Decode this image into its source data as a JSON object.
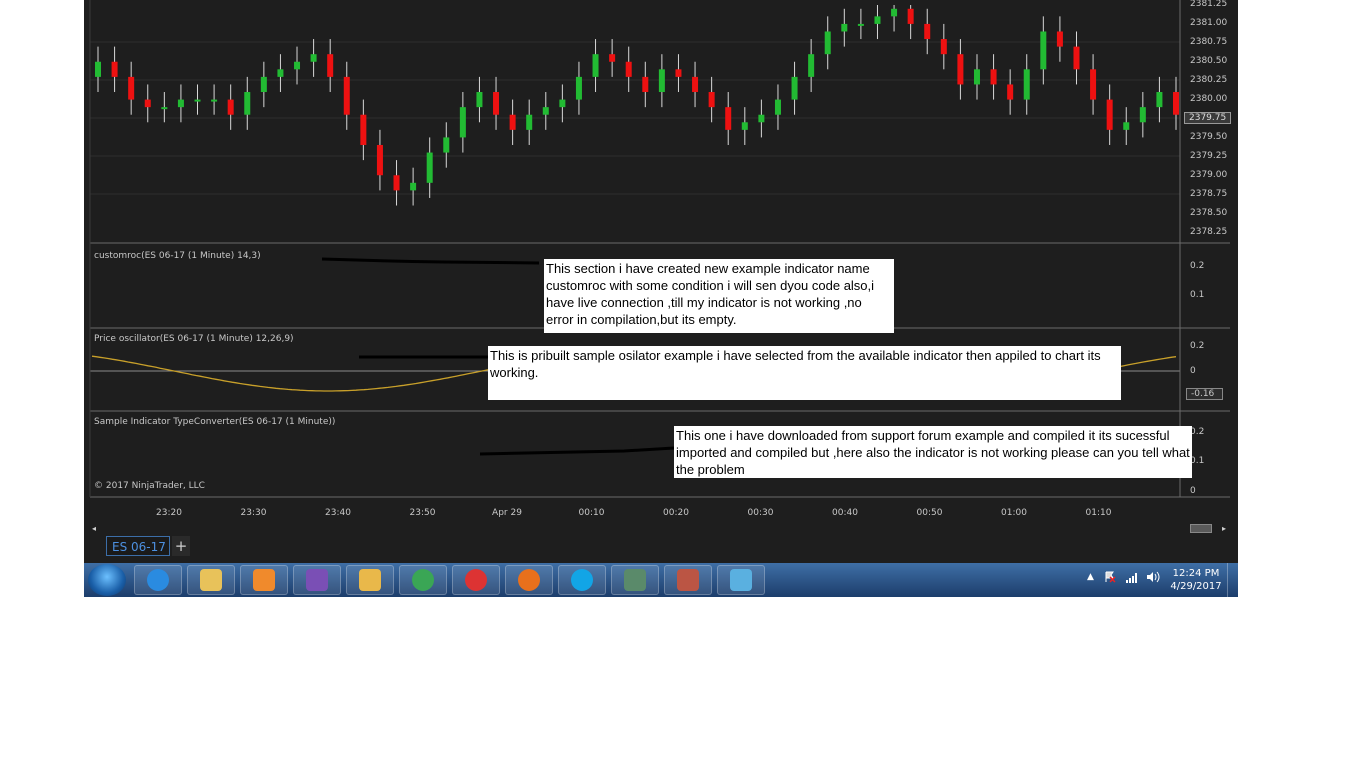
{
  "panels": {
    "price_axis_labels": [
      "2381.25",
      "2381.00",
      "2380.75",
      "2380.50",
      "2380.25",
      "2380.00",
      "2379.75",
      "2379.50",
      "2379.25",
      "2379.00",
      "2378.75",
      "2378.50",
      "2378.25"
    ],
    "current_price": "2379.75",
    "indicator1": {
      "title": "customroc(ES 06-17 (1 Minute) 14,3)",
      "axis": [
        "0.2",
        "0.1"
      ]
    },
    "indicator2": {
      "title": "Price oscillator(ES 06-17 (1 Minute) 12,26,9)",
      "axis": [
        "0.2",
        "0"
      ],
      "current_value": "-0.16"
    },
    "indicator3": {
      "title": "Sample Indicator TypeConverter(ES 06-17 (1 Minute))",
      "axis": [
        "0.2",
        "0.1",
        "0"
      ]
    },
    "copyright": "© 2017 NinjaTrader, LLC"
  },
  "time_axis": [
    "23:20",
    "23:30",
    "23:40",
    "23:50",
    "Apr 29",
    "00:10",
    "00:20",
    "00:30",
    "00:40",
    "00:50",
    "01:00",
    "01:10"
  ],
  "notes": [
    "This section i have created new example indicator name customroc with some condition i will sen dyou code also,i have live connection ,till my indicator is not working ,no error in compilation,but its empty.",
    "This is pribuilt sample osilator example i have selected from the available indicator then appiled to chart its working.",
    "This one i have downloaded from support forum example and compiled it its sucessful imported and compiled but ,here also the indicator is not working please can you tell what the problem"
  ],
  "tab": {
    "label": "ES 06-17",
    "add": "+"
  },
  "taskbar": {
    "apps": [
      "internet-explorer",
      "file-explorer",
      "media-player",
      "visual-studio",
      "outlook",
      "chrome",
      "app-red-dot",
      "firefox",
      "skype",
      "ninjatrader",
      "app-badge",
      "paint"
    ],
    "clock_time": "12:24 PM",
    "clock_date": "4/29/2017"
  },
  "colors": {
    "up": "#22bb33",
    "down": "#ee1111",
    "oscillator": "#c8a02a",
    "background": "#1e1e1e"
  },
  "chart_data": {
    "type": "candlestick",
    "instrument": "ES 06-17 (1 Minute)",
    "y_range": [
      2378.25,
      2381.25
    ],
    "bars_ohlc_approx": {
      "open": [
        2380.3,
        2380.5,
        2380.3,
        2380.0,
        2379.9,
        2379.9,
        2380.0,
        2380.0,
        2380.0,
        2379.8,
        2380.1,
        2380.3,
        2380.4,
        2380.5,
        2380.6,
        2380.3,
        2379.8,
        2379.4,
        2379.0,
        2378.8,
        2378.9,
        2379.3,
        2379.5,
        2379.9,
        2380.1,
        2379.8,
        2379.6,
        2379.8,
        2379.9,
        2380.0,
        2380.3,
        2380.6,
        2380.5,
        2380.3,
        2380.1,
        2380.4,
        2380.3,
        2380.1,
        2379.9,
        2379.6,
        2379.7,
        2379.8,
        2380.0,
        2380.3,
        2380.6,
        2380.9,
        2381.0,
        2381.0,
        2381.1,
        2381.2,
        2381.0,
        2380.8,
        2380.6,
        2380.2,
        2380.4,
        2380.2,
        2380.0,
        2380.4,
        2380.9,
        2380.7,
        2380.4,
        2380.0,
        2379.6,
        2379.7,
        2379.9,
        2380.1
      ],
      "close": [
        2380.5,
        2380.3,
        2380.0,
        2379.9,
        2379.9,
        2380.0,
        2380.0,
        2380.0,
        2379.8,
        2380.1,
        2380.3,
        2380.4,
        2380.5,
        2380.6,
        2380.3,
        2379.8,
        2379.4,
        2379.0,
        2378.8,
        2378.9,
        2379.3,
        2379.5,
        2379.9,
        2380.1,
        2379.8,
        2379.6,
        2379.8,
        2379.9,
        2380.0,
        2380.3,
        2380.6,
        2380.5,
        2380.3,
        2380.1,
        2380.4,
        2380.3,
        2380.1,
        2379.9,
        2379.6,
        2379.7,
        2379.8,
        2380.0,
        2380.3,
        2380.6,
        2380.9,
        2381.0,
        2381.0,
        2381.1,
        2381.2,
        2381.0,
        2380.8,
        2380.6,
        2380.2,
        2380.4,
        2380.2,
        2380.0,
        2380.4,
        2380.9,
        2380.7,
        2380.4,
        2380.0,
        2379.6,
        2379.7,
        2379.9,
        2380.1,
        2379.8
      ]
    },
    "time_labels": [
      "23:20",
      "23:30",
      "23:40",
      "23:50",
      "Apr 29",
      "00:10",
      "00:20",
      "00:30",
      "00:40",
      "00:50",
      "01:00",
      "01:10"
    ]
  }
}
